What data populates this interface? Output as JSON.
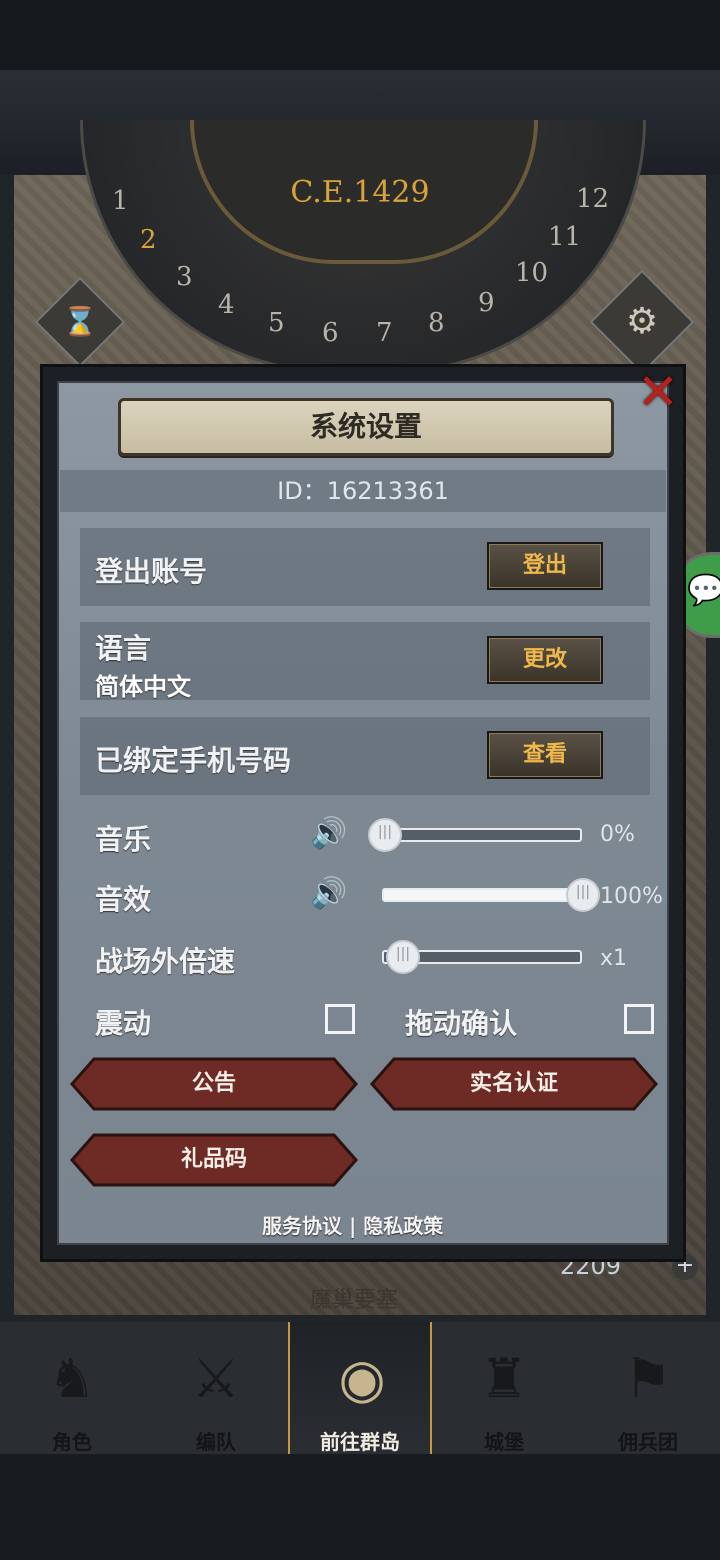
{
  "map": {
    "era": "C.E.1429",
    "dial_numbers": [
      "1",
      "2",
      "3",
      "4",
      "5",
      "6",
      "7",
      "8",
      "9",
      "10",
      "11",
      "12"
    ],
    "resource_value": "2209",
    "place_name": "魔巢要塞"
  },
  "dialog": {
    "title": "系统设置",
    "id_text": "ID：16213361",
    "logout": {
      "label": "登出账号",
      "button": "登出"
    },
    "language": {
      "label": "语言",
      "current": "简体中文",
      "button": "更改"
    },
    "phone": {
      "label": "已绑定手机号码",
      "button": "查看"
    },
    "music": {
      "label": "音乐",
      "value": 0,
      "value_text": "0%"
    },
    "sound": {
      "label": "音效",
      "value": 100,
      "value_text": "100%"
    },
    "speed": {
      "label": "战场外倍速",
      "value": 0,
      "value_text": "x1"
    },
    "vibration": {
      "label": "震动",
      "checked": false
    },
    "drag_confirm": {
      "label": "拖动确认",
      "checked": false
    },
    "buttons": {
      "notice": "公告",
      "realname": "实名认证",
      "gift_code": "礼品码"
    },
    "footer": {
      "service": "服务协议",
      "separator": "|",
      "privacy": "隐私政策"
    }
  },
  "nav": [
    {
      "label": "角色",
      "icon": "knight-icon",
      "active": false
    },
    {
      "label": "编队",
      "icon": "squad-icon",
      "active": false
    },
    {
      "label": "前往群岛",
      "icon": "islands-icon",
      "active": true
    },
    {
      "label": "城堡",
      "icon": "castle-icon",
      "active": false
    },
    {
      "label": "佣兵团",
      "icon": "mercenary-icon",
      "active": false
    }
  ],
  "colors": {
    "accent_gold": "#f0b84a",
    "close_red": "#b8211b",
    "button_red": "#6e2a24"
  }
}
